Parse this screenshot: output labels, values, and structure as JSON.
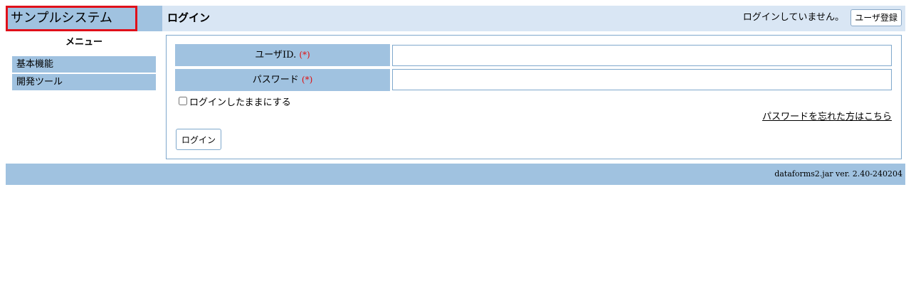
{
  "app": {
    "title": "サンプルシステム"
  },
  "header": {
    "page_title": "ログイン",
    "login_status": "ログインしていません。",
    "register_label": "ユーザ登録"
  },
  "sidebar": {
    "heading": "メニュー",
    "items": [
      {
        "label": "基本機能"
      },
      {
        "label": "開発ツール"
      }
    ]
  },
  "form": {
    "user_id_label": "ユーザID.",
    "password_label": "パスワード",
    "required_mark": "(*)",
    "user_id_value": "",
    "password_value": "",
    "remember_label": "ログインしたままにする",
    "remember_checked": false,
    "forgot_link": "パスワードを忘れた方はこちら",
    "login_button": "ログイン"
  },
  "footer": {
    "version": "dataforms2.jar ver. 2.40-240204"
  },
  "colors": {
    "accent": "#a0c2e0",
    "header_bg": "#d9e6f4",
    "highlight_border": "#e0101a",
    "required": "#e01010"
  }
}
